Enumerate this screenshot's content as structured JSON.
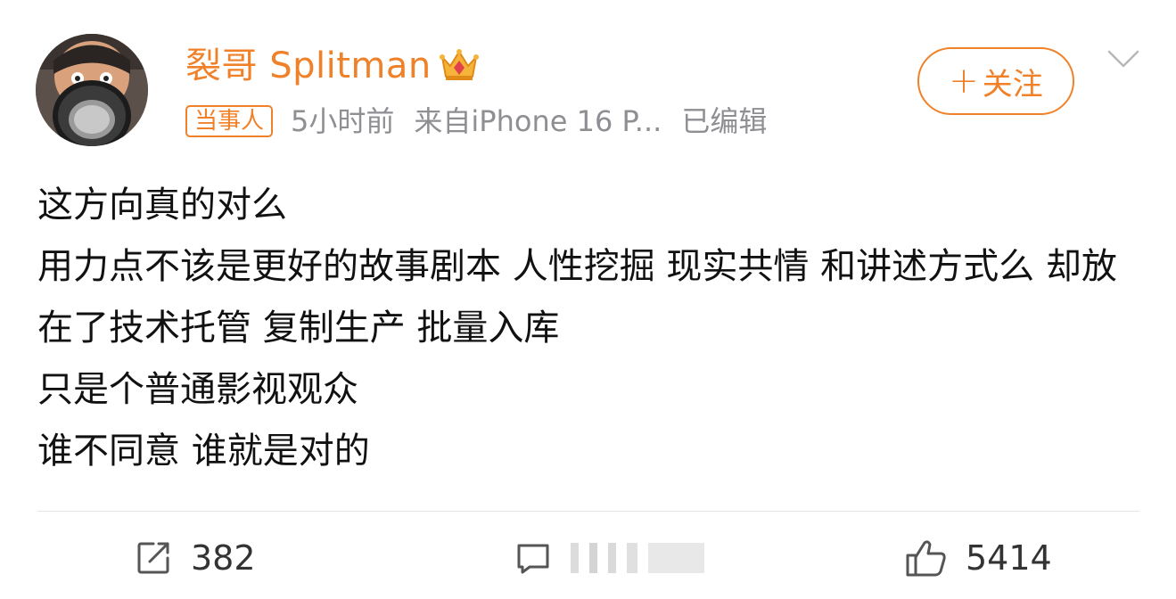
{
  "post": {
    "author": {
      "name": "裂哥 Splitman",
      "badge_icon": "crown-icon",
      "avatar": "user-avatar"
    },
    "meta": {
      "party_badge": "当事人",
      "time": "5小时前",
      "source": "来自iPhone 16 P...",
      "edited": "已编辑"
    },
    "follow_button": {
      "plus": "+",
      "label": "关注"
    },
    "body_lines": [
      "这方向真的对么",
      "用力点不该是更好的故事剧本 人性挖掘 现实共情 和讲述方式么 却放在了技术托管 复制生产 批量入库",
      "只是个普通影视观众",
      "谁不同意 谁就是对的"
    ],
    "actions": {
      "repost_count": "382",
      "comment_count": "",
      "like_count": "5414"
    }
  },
  "colors": {
    "accent": "#f08129",
    "meta_text": "#8e8e93",
    "body_text": "#111111"
  }
}
